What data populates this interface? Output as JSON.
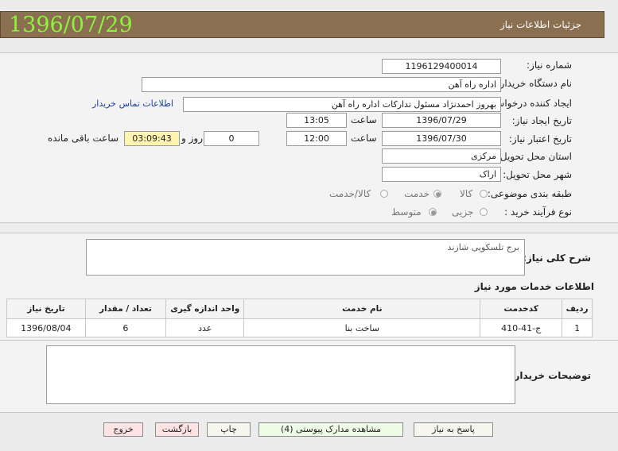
{
  "header": {
    "title": "جزئیات اطلاعات نیاز",
    "date": "1396/07/29"
  },
  "form": {
    "need_number": {
      "label": "شماره نیاز:",
      "value": "1196129400014"
    },
    "buyer_org": {
      "label": "نام دستگاه خریدار:",
      "value": "اداره راه آهن"
    },
    "requester": {
      "label": "ایجاد کننده درخواست:",
      "value": "بهروز احمدنژاد مسئول تدارکات اداره راه آهن",
      "link": "اطلاعات تماس خریدار"
    },
    "created": {
      "label": "تاریخ ایجاد نیاز:",
      "date": "1396/07/29",
      "time_label": "ساعت",
      "time": "13:05"
    },
    "validity": {
      "label": "تاریخ اعتبار نیاز:",
      "date": "1396/07/30",
      "time_label": "ساعت",
      "time": "12:00",
      "days": "0",
      "days_label": "روز و",
      "remaining": "03:09:43",
      "remaining_label": "ساعت باقی مانده"
    },
    "province": {
      "label": "استان محل تحویل:",
      "value": "مرکزی"
    },
    "city": {
      "label": "شهر محل تحویل:",
      "value": "اراک"
    },
    "category": {
      "label": "طبقه بندی موضوعی:",
      "options": [
        "کالا",
        "خدمت",
        "کالا/خدمت"
      ],
      "selected": "خدمت"
    },
    "process": {
      "label": "نوع فرآیند خرید :",
      "options": [
        "جزیی",
        "متوسط"
      ],
      "selected": "متوسط"
    }
  },
  "summary": {
    "label": "شرح کلی نیاز:",
    "value": "برج تلسکوپی شازند"
  },
  "services": {
    "title": "اطلاعات خدمات مورد نیاز",
    "columns": [
      "ردیف",
      "کدخدمت",
      "نام خدمت",
      "واحد اندازه گیری",
      "تعداد / مقدار",
      "تاریخ نیاز"
    ],
    "rows": [
      {
        "row": "1",
        "code": "ج-41-410",
        "name": "ساخت بنا",
        "unit": "عدد",
        "qty": "6",
        "date": "1396/08/04"
      }
    ]
  },
  "notes": {
    "label": "توضیحات خریدار:",
    "value": ""
  },
  "buttons": {
    "reply": "پاسخ به نیاز",
    "attachments": "مشاهده مدارک پیوستی (4)",
    "print": "چاپ",
    "back": "بازگشت",
    "exit": "خروج"
  },
  "colors": {
    "header_bg": "#8a7050",
    "date_color": "#8df33d",
    "remaining_bg": "#fff3b0"
  }
}
